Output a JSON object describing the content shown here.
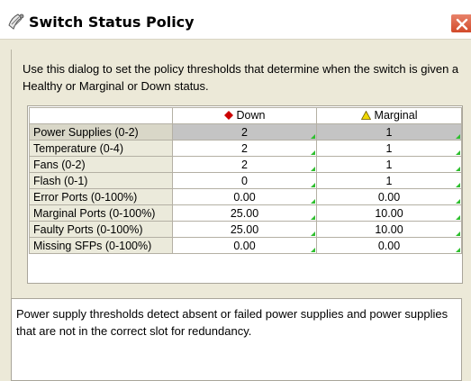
{
  "window": {
    "title": "Switch Status Policy",
    "icon": "switch-policy-icon",
    "close_icon": "close-icon"
  },
  "intro_text": "Use this dialog to set the policy thresholds that determine when the switch is given a Healthy or Marginal or Down status.",
  "table": {
    "columns": [
      {
        "label": "Down",
        "icon": "red-diamond-icon",
        "color": "#cc0000"
      },
      {
        "label": "Marginal",
        "icon": "yellow-triangle-icon",
        "color": "#f0d800"
      }
    ],
    "rows": [
      {
        "label": "Power Supplies (0-2)",
        "down": "2",
        "marginal": "1"
      },
      {
        "label": "Temperature (0-4)",
        "down": "2",
        "marginal": "1"
      },
      {
        "label": "Fans (0-2)",
        "down": "2",
        "marginal": "1"
      },
      {
        "label": "Flash (0-1)",
        "down": "0",
        "marginal": "1"
      },
      {
        "label": "Error Ports (0-100%)",
        "down": "0.00",
        "marginal": "0.00"
      },
      {
        "label": "Marginal Ports (0-100%)",
        "down": "25.00",
        "marginal": "10.00"
      },
      {
        "label": "Faulty Ports (0-100%)",
        "down": "25.00",
        "marginal": "10.00"
      },
      {
        "label": "Missing SFPs (0-100%)",
        "down": "0.00",
        "marginal": "0.00"
      }
    ],
    "selected_row": 0
  },
  "description": "Power supply thresholds detect absent or failed power supplies and power supplies that are not in the correct slot for redundancy.",
  "colors": {
    "edit_marker": "#2fbf2f",
    "close_button": "#d24a2a",
    "selected_row": "#c4c4c4"
  }
}
